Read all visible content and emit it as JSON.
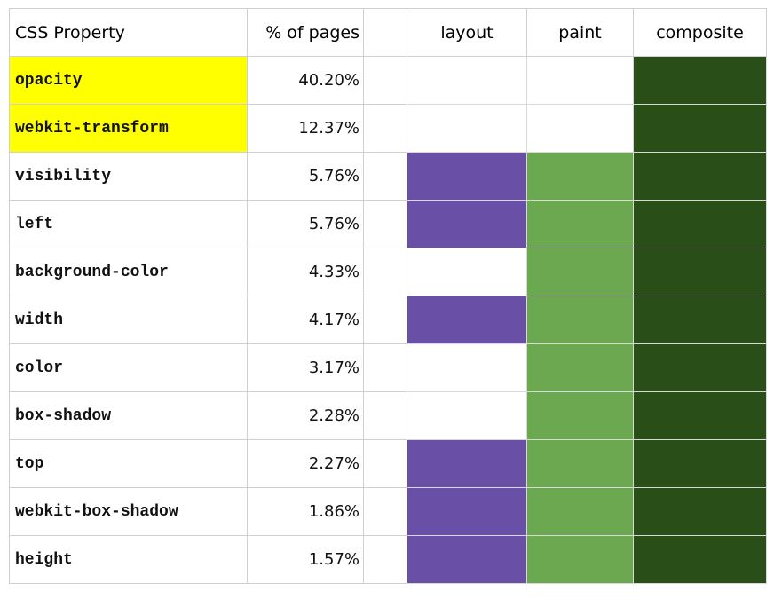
{
  "table": {
    "headers": {
      "property": "CSS Property",
      "percent": "% of pages",
      "spacer": "",
      "layout": "layout",
      "paint": "paint",
      "composite": "composite"
    },
    "colors": {
      "highlight": "#ffff00",
      "layout": "#6a4fa7",
      "paint": "#6ca84f",
      "composite": "#294e17"
    },
    "rows": [
      {
        "property": "opacity",
        "percent": "40.20%",
        "highlight": true,
        "layout": false,
        "paint": false,
        "composite": true
      },
      {
        "property": "webkit-transform",
        "percent": "12.37%",
        "highlight": true,
        "layout": false,
        "paint": false,
        "composite": true
      },
      {
        "property": "visibility",
        "percent": "5.76%",
        "highlight": false,
        "layout": true,
        "paint": true,
        "composite": true
      },
      {
        "property": "left",
        "percent": "5.76%",
        "highlight": false,
        "layout": true,
        "paint": true,
        "composite": true
      },
      {
        "property": "background-color",
        "percent": "4.33%",
        "highlight": false,
        "layout": false,
        "paint": true,
        "composite": true
      },
      {
        "property": "width",
        "percent": "4.17%",
        "highlight": false,
        "layout": true,
        "paint": true,
        "composite": true
      },
      {
        "property": "color",
        "percent": "3.17%",
        "highlight": false,
        "layout": false,
        "paint": true,
        "composite": true
      },
      {
        "property": "box-shadow",
        "percent": "2.28%",
        "highlight": false,
        "layout": false,
        "paint": true,
        "composite": true
      },
      {
        "property": "top",
        "percent": "2.27%",
        "highlight": false,
        "layout": true,
        "paint": true,
        "composite": true
      },
      {
        "property": "webkit-box-shadow",
        "percent": "1.86%",
        "highlight": false,
        "layout": true,
        "paint": true,
        "composite": true
      },
      {
        "property": "height",
        "percent": "1.57%",
        "highlight": false,
        "layout": true,
        "paint": true,
        "composite": true
      }
    ]
  }
}
